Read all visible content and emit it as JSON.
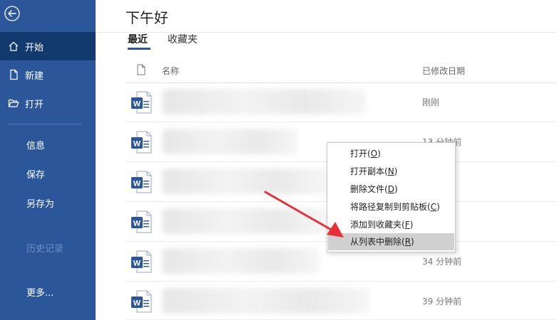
{
  "sidebar": {
    "items": [
      {
        "label": "开始"
      },
      {
        "label": "新建"
      },
      {
        "label": "打开"
      },
      {
        "label": "信息"
      },
      {
        "label": "保存"
      },
      {
        "label": "另存为"
      },
      {
        "label": "历史记录"
      },
      {
        "label": "更多..."
      }
    ]
  },
  "main": {
    "greeting": "下午好",
    "tabs": [
      {
        "label": "最近"
      },
      {
        "label": "收藏夹"
      }
    ],
    "columns": {
      "name": "名称",
      "modified": "已修改日期"
    },
    "files": [
      {
        "date": "刚刚"
      },
      {
        "date": "13 分钟前"
      },
      {
        "date": ""
      },
      {
        "date": ""
      },
      {
        "date": "34 分钟前"
      },
      {
        "date": "39 分钟前"
      }
    ]
  },
  "context_menu": {
    "items": [
      {
        "label": "打开(",
        "key": "O",
        "close": ")"
      },
      {
        "label": "打开副本(",
        "key": "N",
        "close": ")"
      },
      {
        "label": "删除文件(",
        "key": "D",
        "close": ")"
      },
      {
        "label": "将路径复制到剪贴板(",
        "key": "C",
        "close": ")"
      },
      {
        "label": "添加到收藏夹(",
        "key": "F",
        "close": ")"
      },
      {
        "label": "从列表中删除(",
        "key": "R",
        "close": ")"
      }
    ]
  },
  "icons": {
    "file_type": "W"
  },
  "colors": {
    "sidebar": "#2b579a",
    "sidebar_active": "#123a6f",
    "word_blue": "#2b579a",
    "arrow": "#e8303a"
  }
}
